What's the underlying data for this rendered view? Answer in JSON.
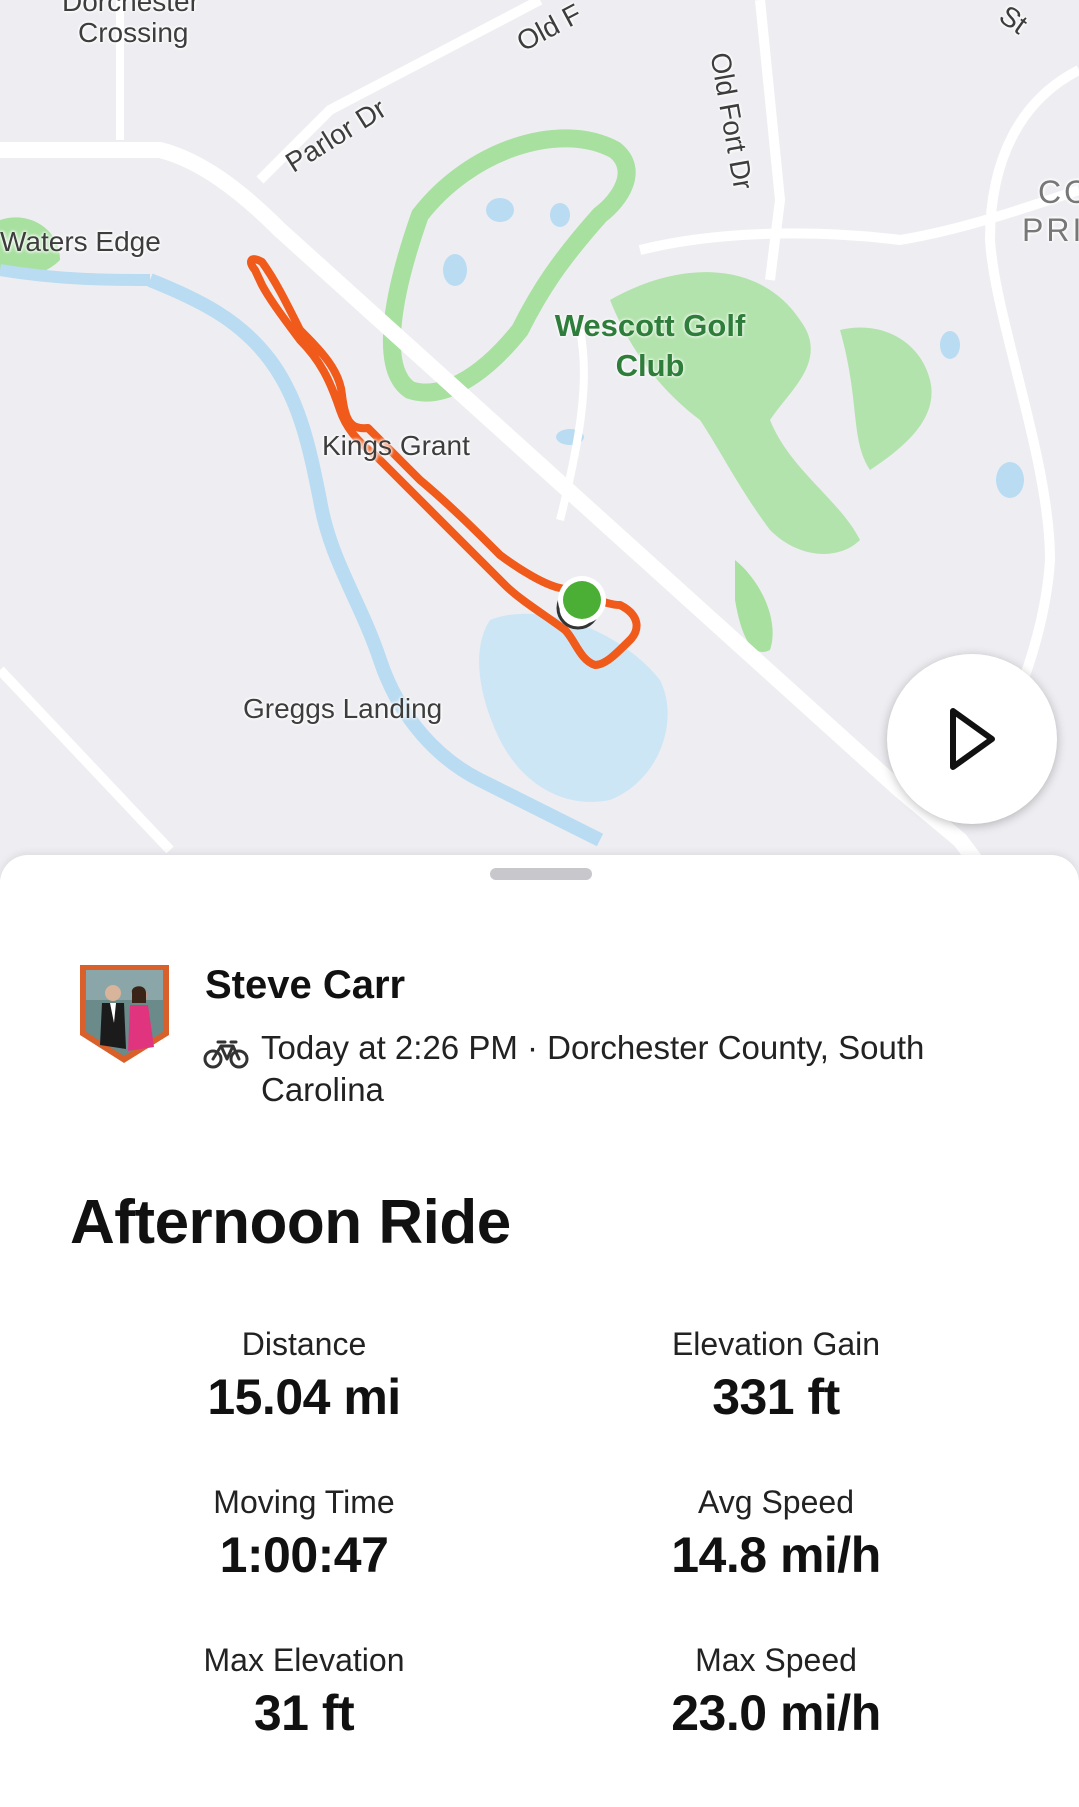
{
  "map": {
    "labels": {
      "dorchester_crossing_top": "Dorchester",
      "dorchester_crossing": "Crossing",
      "old_fort_top": "Old F",
      "st": "St",
      "old_fort_dr": "Old Fort Dr",
      "parlor_dr": "Parlor Dr",
      "waters_edge": "Waters Edge",
      "co": "CO",
      "pri": "PRI",
      "wescott_line1": "Wescott Golf",
      "wescott_line2": "Club",
      "kings_grant": "Kings Grant",
      "greggs_landing": "Greggs Landing"
    },
    "route_color": "#f05a1a",
    "marker_color": "#4caf35"
  },
  "play_button": {
    "icon": "play-icon"
  },
  "athlete": {
    "name": "Steve Carr",
    "activity_icon": "bike-icon",
    "meta": "Today at 2:26 PM · Dorchester County, South Carolina"
  },
  "activity": {
    "title": "Afternoon Ride"
  },
  "stats": {
    "distance": {
      "label": "Distance",
      "value": "15.04 mi"
    },
    "elevation_gain": {
      "label": "Elevation Gain",
      "value": "331 ft"
    },
    "moving_time": {
      "label": "Moving Time",
      "value": "1:00:47"
    },
    "avg_speed": {
      "label": "Avg Speed",
      "value": "14.8 mi/h"
    },
    "max_elevation": {
      "label": "Max Elevation",
      "value": "31 ft"
    },
    "max_speed": {
      "label": "Max Speed",
      "value": "23.0 mi/h"
    }
  }
}
